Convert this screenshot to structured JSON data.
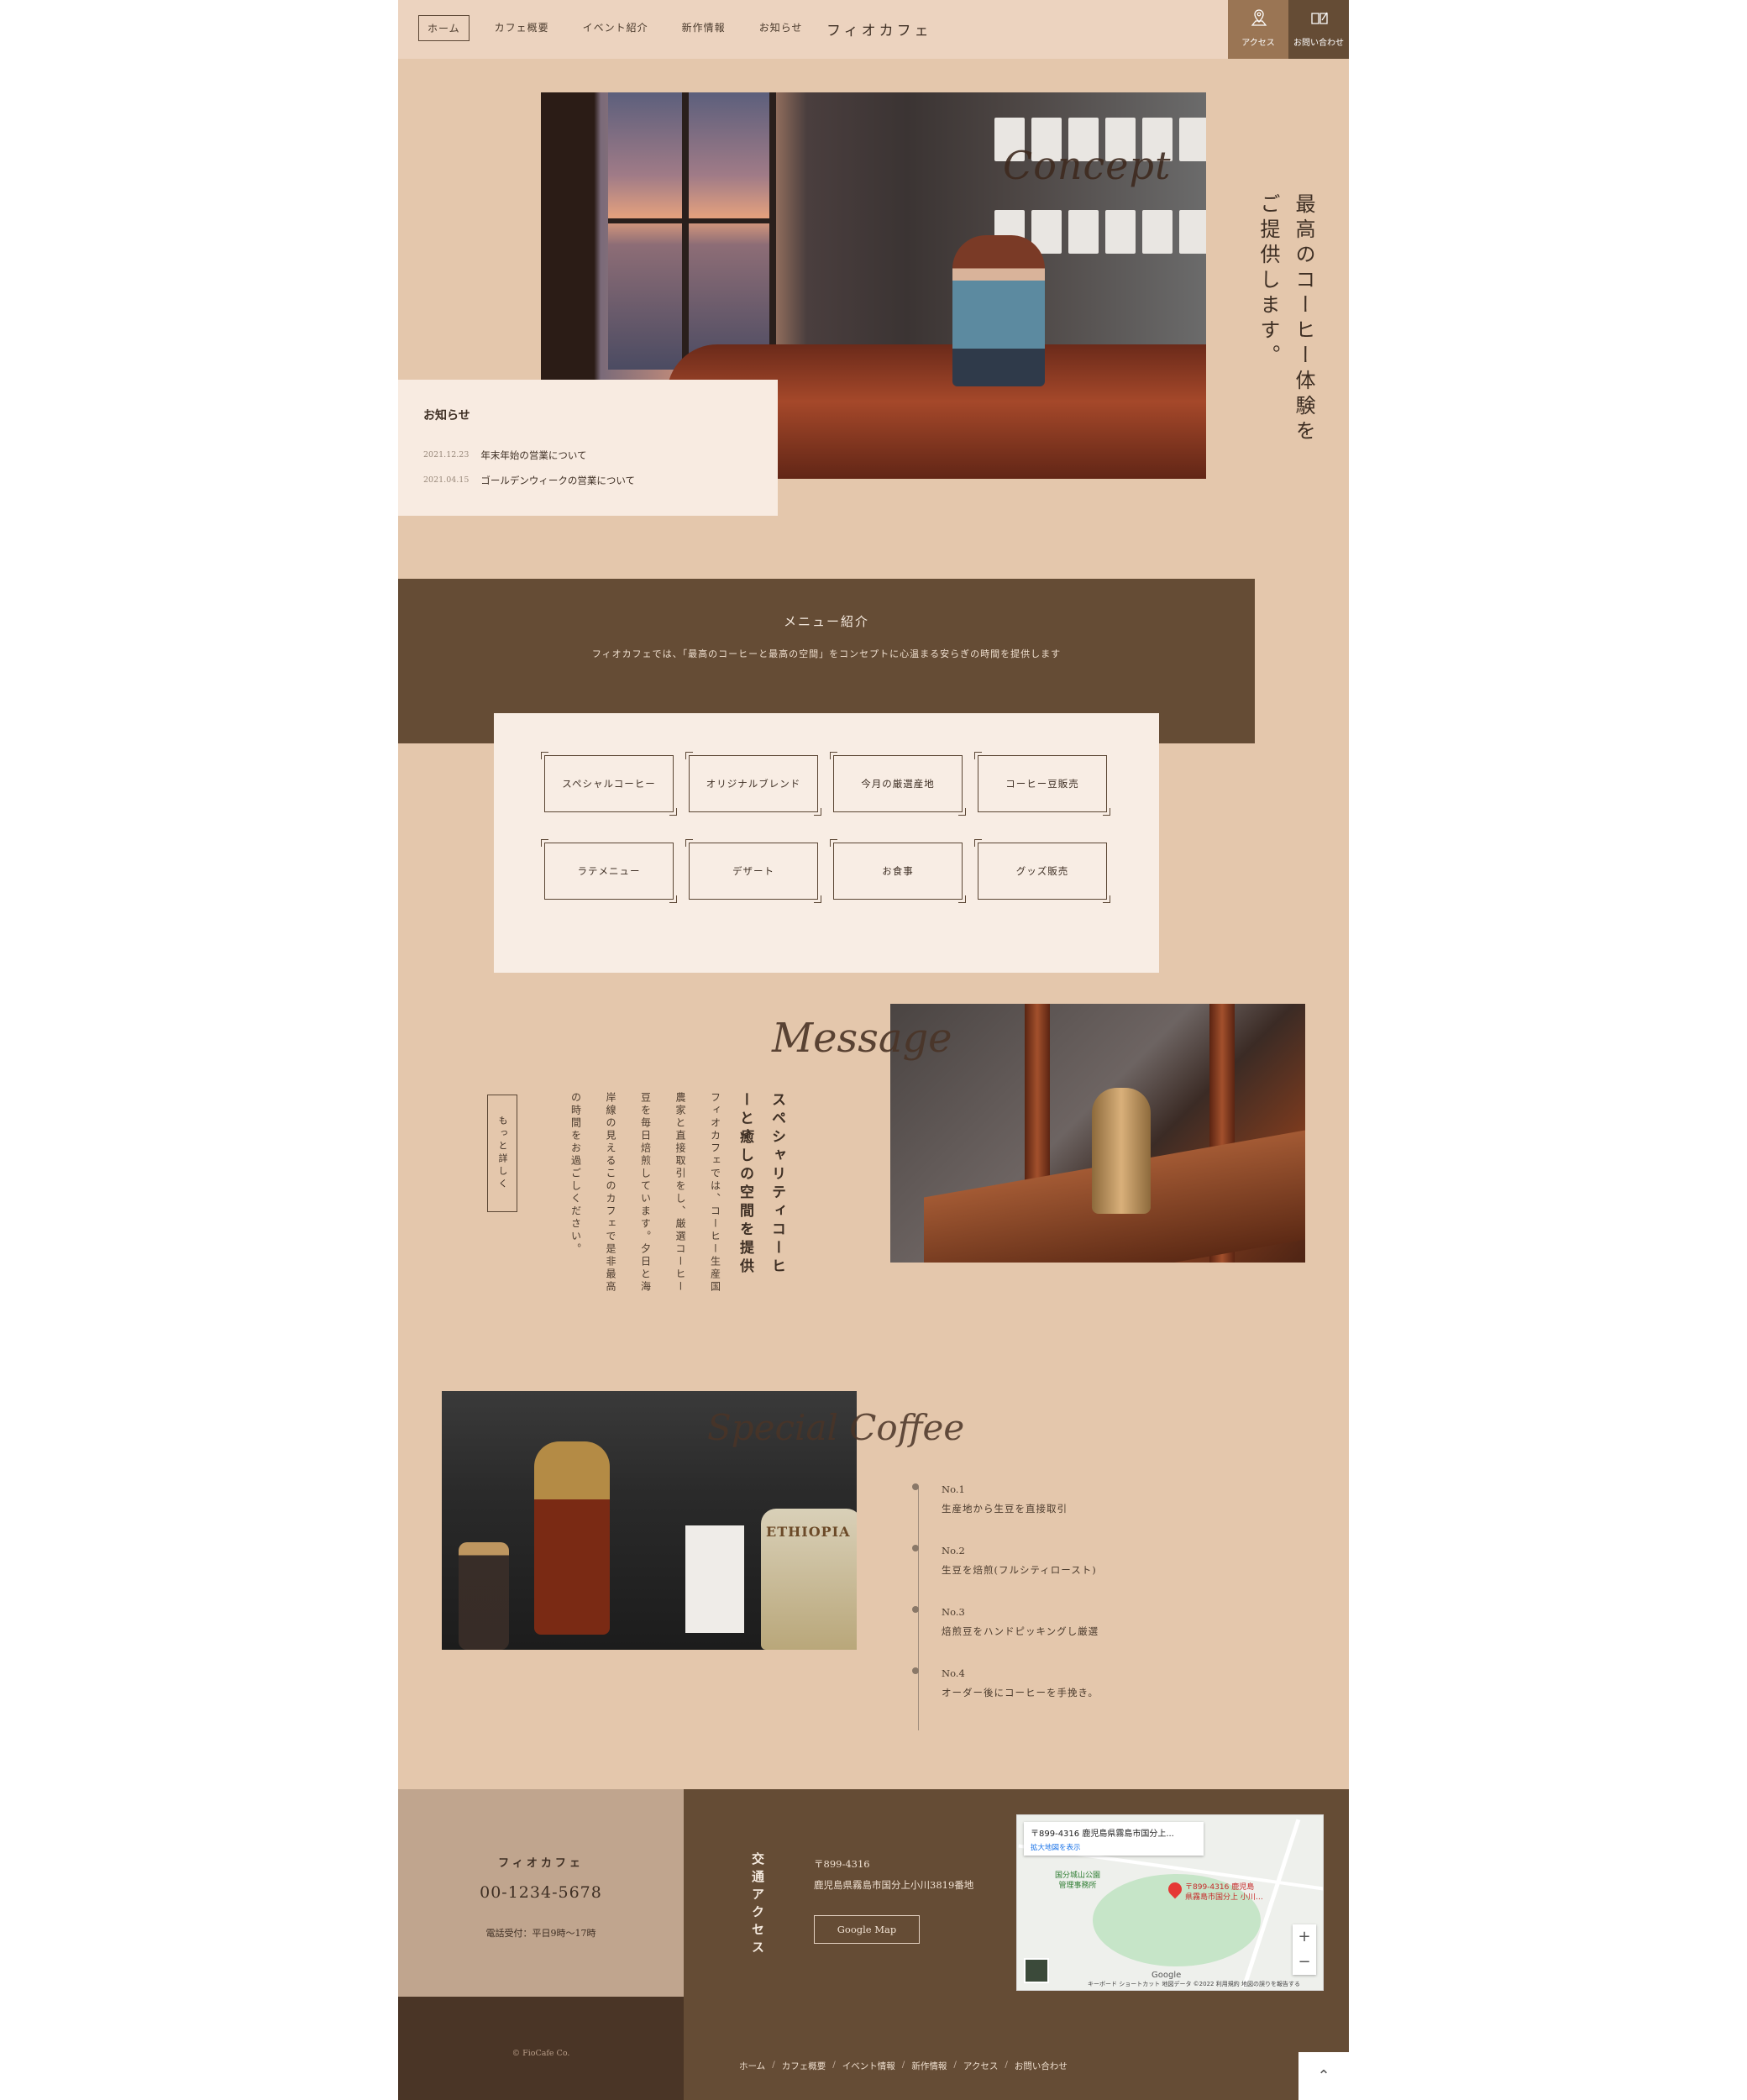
{
  "header": {
    "nav": [
      {
        "label": "ホーム",
        "active": true
      },
      {
        "label": "カフェ概要"
      },
      {
        "label": "イベント紹介"
      },
      {
        "label": "新作情報"
      },
      {
        "label": "お知らせ"
      }
    ],
    "brand": "フィオカフェ",
    "access_label": "アクセス",
    "contact_label": "お問い合わせ",
    "colors": {
      "access_bg": "#9a7554",
      "contact_bg": "#654c35"
    }
  },
  "hero": {
    "script_title": "Concept",
    "tagline": "最高のコーヒー体験をご提供します。",
    "photo_icon": "cafe-counter-photo"
  },
  "news": {
    "title": "お知らせ",
    "items": [
      {
        "date": "2021.12.23",
        "text": "年末年始の営業について"
      },
      {
        "date": "2021.04.15",
        "text": "ゴールデンウィークの営業について"
      }
    ]
  },
  "menu": {
    "heading": "メニュー紹介",
    "subtitle": "フィオカフェでは、「最高のコーヒーと最高の空間」をコンセプトに心温まる安らぎの時間を提供します",
    "items": [
      "スペシャルコーヒー",
      "オリジナルブレンド",
      "今月の厳選産地",
      "コーヒー豆販売",
      "ラテメニュー",
      "デザート",
      "お食事",
      "グッズ販売"
    ]
  },
  "message": {
    "script_title": "Message",
    "heading": "スペシャリティコーヒーと癒しの空間を提供",
    "body": "フィオカフェでは、コーヒー生産国農家と直接取引をし、厳選コーヒー豆を毎日焙煎しています。夕日と海岸線の見えるこのカフェで是非最高の時間をお過ごしください。",
    "more_label": "もっと詳しく"
  },
  "special": {
    "script_title": "Special Coffee",
    "pack_text": "ETHIOPIA",
    "items": [
      {
        "no": "No.1",
        "text": "生産地から生豆を直接取引"
      },
      {
        "no": "No.2",
        "text": "生豆を焙煎(フルシティロースト)"
      },
      {
        "no": "No.3",
        "text": "焙煎豆をハンドピッキングし厳選"
      },
      {
        "no": "No.4",
        "text": "オーダー後にコーヒーを手挽き。"
      }
    ]
  },
  "footer": {
    "name": "フィオカフェ",
    "tel": "00-1234-5678",
    "hours": "電話受付：平日9時〜17時",
    "copyright": "© FioCafe Co.",
    "access_title": "交通アクセス",
    "zip": "〒899-4316",
    "address": "鹿児島県霧島市国分上小川3819番地",
    "gmap_label": "Google Map",
    "map": {
      "title": "〒899-4316 鹿児島県霧島市国分上...",
      "link": "拡大地図を表示",
      "park_label": "国分城山公園\n管理事務所",
      "pin_label": "〒899-4316 鹿児島\n県霧島市国分上 小川…",
      "google": "Google",
      "attribution": "キーボード ショートカット   地図データ ©2022   利用規約   地図の誤りを報告する"
    },
    "links": [
      "ホーム",
      "カフェ概要",
      "イベント情報",
      "新作情報",
      "アクセス",
      "お問い合わせ"
    ]
  },
  "to_top": "⌃"
}
